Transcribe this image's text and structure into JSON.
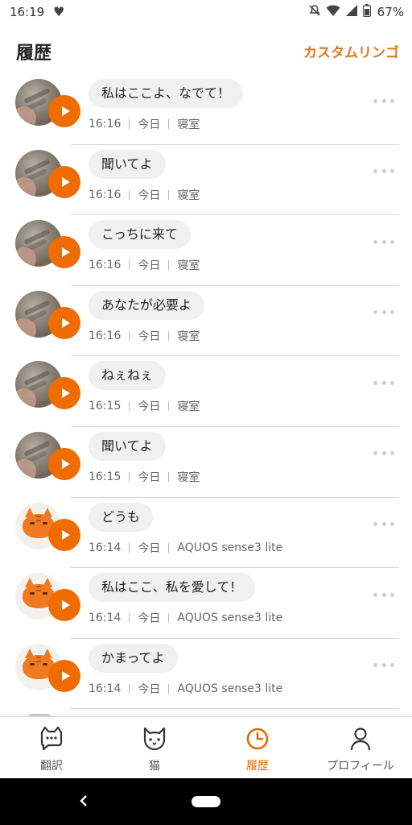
{
  "status_bar": {
    "time": "16:19",
    "battery": "67%"
  },
  "header": {
    "title": "履歴",
    "action_label": "カスタムリンゴ"
  },
  "items": [
    {
      "message": "私はここよ、なでて！",
      "time": "16:16",
      "day": "今日",
      "place": "寝室",
      "avatar": "cat-photo"
    },
    {
      "message": "聞いてよ",
      "time": "16:16",
      "day": "今日",
      "place": "寝室",
      "avatar": "cat-photo"
    },
    {
      "message": "こっちに来て",
      "time": "16:16",
      "day": "今日",
      "place": "寝室",
      "avatar": "cat-photo"
    },
    {
      "message": "あなたが必要よ",
      "time": "16:16",
      "day": "今日",
      "place": "寝室",
      "avatar": "cat-photo"
    },
    {
      "message": "ねぇねぇ",
      "time": "16:15",
      "day": "今日",
      "place": "寝室",
      "avatar": "cat-photo"
    },
    {
      "message": "聞いてよ",
      "time": "16:15",
      "day": "今日",
      "place": "寝室",
      "avatar": "cat-photo"
    },
    {
      "message": "どうも",
      "time": "16:14",
      "day": "今日",
      "place": "AQUOS sense3 lite",
      "avatar": "orange-cat-illustration"
    },
    {
      "message": "私はここ、私を愛して！",
      "time": "16:14",
      "day": "今日",
      "place": "AQUOS sense3 lite",
      "avatar": "orange-cat-illustration"
    },
    {
      "message": "かまってよ",
      "time": "16:14",
      "day": "今日",
      "place": "AQUOS sense3 lite",
      "avatar": "orange-cat-illustration"
    }
  ],
  "bottom_nav": [
    {
      "label": "翻訳",
      "icon": "chat-cat-icon",
      "active": false
    },
    {
      "label": "猫",
      "icon": "cat-face-icon",
      "active": false
    },
    {
      "label": "履歴",
      "icon": "clock-icon",
      "active": true
    },
    {
      "label": "プロフィール",
      "icon": "person-icon",
      "active": false
    }
  ],
  "colors": {
    "accent": "#ef6c00",
    "accent_text": "#e07a1f",
    "bubble": "#f0f0f0"
  }
}
